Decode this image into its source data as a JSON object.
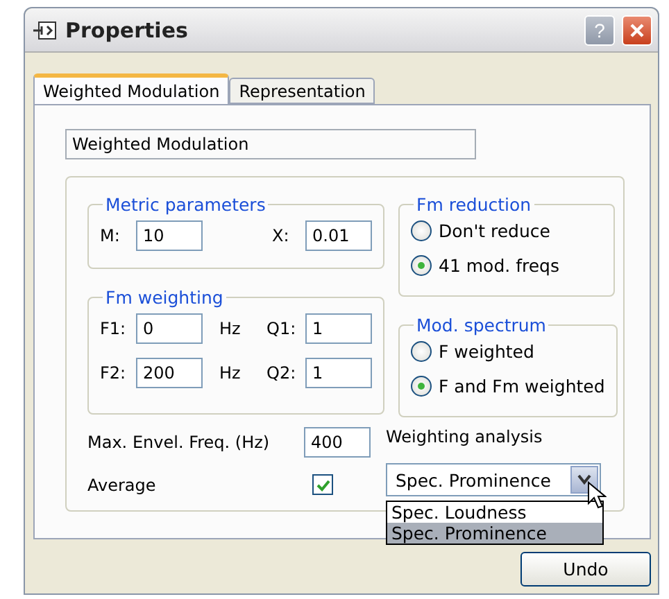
{
  "window": {
    "title": "Properties",
    "help_button": "?"
  },
  "tabs": [
    {
      "label": "Weighted Modulation",
      "selected": true
    },
    {
      "label": "Representation",
      "selected": false
    }
  ],
  "name_field": {
    "value": "Weighted Modulation"
  },
  "metric_parameters": {
    "title": "Metric parameters",
    "m_label": "M:",
    "m_value": "10",
    "x_label": "X:",
    "x_value": "0.01"
  },
  "fm_weighting": {
    "title": "Fm weighting",
    "rows": [
      {
        "f_label": "F1:",
        "f_value": "0",
        "unit": "Hz",
        "q_label": "Q1:",
        "q_value": "1"
      },
      {
        "f_label": "F2:",
        "f_value": "200",
        "unit": "Hz",
        "q_label": "Q2:",
        "q_value": "1"
      }
    ]
  },
  "fm_reduction": {
    "title": "Fm reduction",
    "options": [
      {
        "label": "Don't reduce",
        "selected": false
      },
      {
        "label": "41 mod. freqs",
        "selected": true
      }
    ]
  },
  "mod_spectrum": {
    "title": "Mod. spectrum",
    "options": [
      {
        "label": "F weighted",
        "selected": false
      },
      {
        "label": "F and Fm weighted",
        "selected": true
      }
    ]
  },
  "max_envel_freq": {
    "label": "Max. Envel. Freq. (Hz)",
    "value": "400"
  },
  "average": {
    "label": "Average",
    "checked": true
  },
  "weighting_analysis": {
    "label": "Weighting analysis",
    "value": "Spec. Prominence",
    "expanded": true,
    "options": [
      {
        "label": "Spec. Loudness",
        "selected": false
      },
      {
        "label": "Spec. Prominence",
        "selected": true
      }
    ]
  },
  "buttons": [
    "Undo"
  ]
}
